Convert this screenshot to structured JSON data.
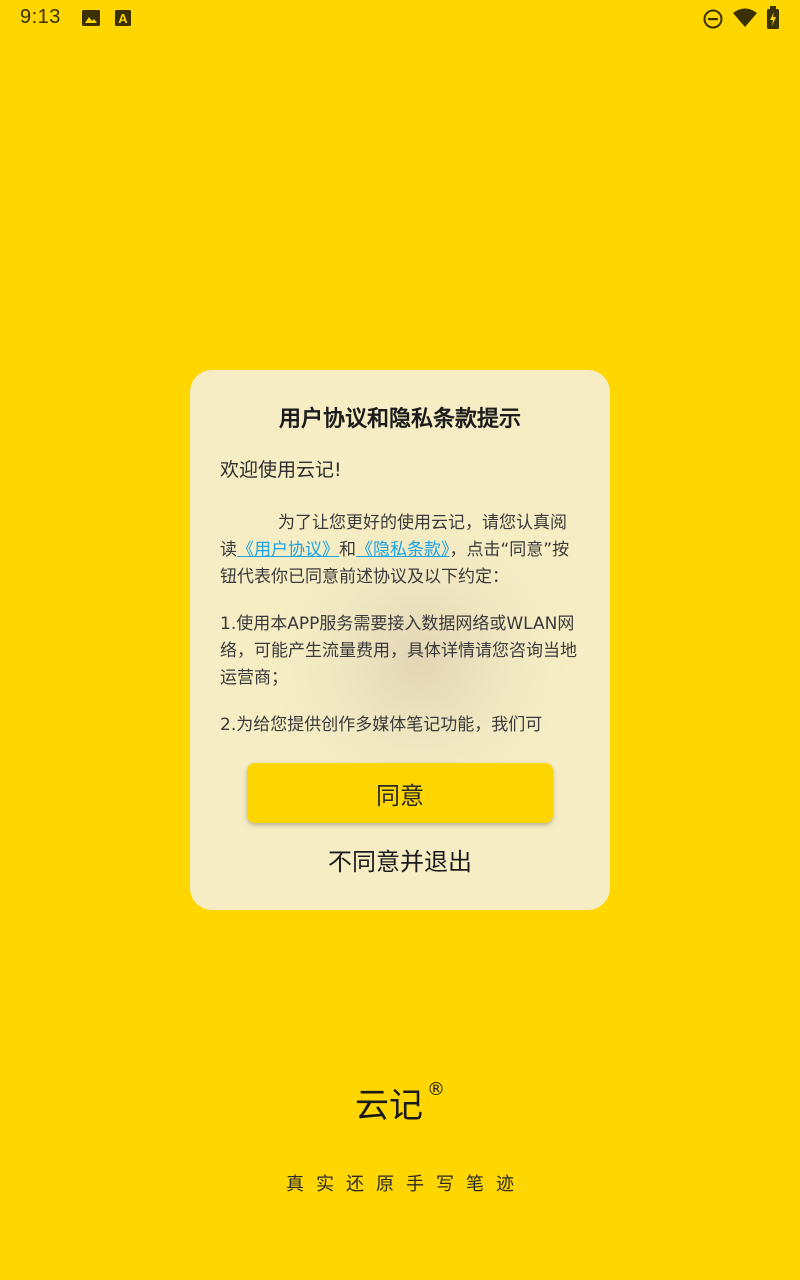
{
  "status_bar": {
    "time": "9:13",
    "icons": [
      "image-icon",
      "a-icon",
      "do-not-disturb-icon",
      "wifi-icon",
      "battery-icon"
    ]
  },
  "dialog": {
    "title": "用户协议和隐私条款提示",
    "welcome": "欢迎使用云记!",
    "para1_intro": "为了让您更好的使用云记，请您认真阅读",
    "user_agreement_link": "《用户协议》",
    "and_text": "和",
    "privacy_link": "《隐私条款》",
    "para1_tail": "，点击“同意”按钮代表你已同意前述协议及以下约定：",
    "para2": " 1.使用本APP服务需要接入数据网络或WLAN网络，可能产生流量费用，具体详情请您咨询当地运营商；",
    "para3": " 2.为给您提供创作多媒体笔记功能，我们可",
    "agree_label": "同意",
    "disagree_label": "不同意并退出"
  },
  "brand": {
    "name": "云记",
    "reg_mark": "®",
    "tagline": "真实还原手写笔迹"
  },
  "colors": {
    "background": "#FFD600",
    "dialog_bg": "#F6EDC4",
    "link": "#1aa3e8",
    "button": "#FFD600"
  }
}
